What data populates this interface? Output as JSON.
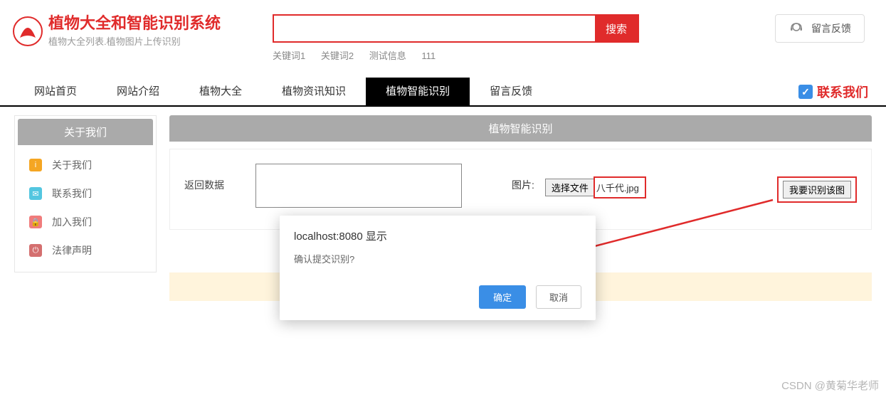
{
  "brand": {
    "title": "植物大全和智能识别系统",
    "subtitle": "植物大全列表.植物图片上传识别"
  },
  "search": {
    "placeholder": "",
    "button": "搜索",
    "keywords": [
      "关键词1",
      "关键词2",
      "测试信息",
      "111"
    ]
  },
  "feedback_button": "留言反馈",
  "nav": {
    "items": [
      "网站首页",
      "网站介绍",
      "植物大全",
      "植物资讯知识",
      "植物智能识别",
      "留言反馈"
    ],
    "active_index": 4
  },
  "contact_label": "联系我们",
  "sidebar": {
    "title": "关于我们",
    "items": [
      {
        "label": "关于我们",
        "icon_color": "#f5a623"
      },
      {
        "label": "联系我们",
        "icon_color": "#53c6e0"
      },
      {
        "label": "加入我们",
        "icon_color": "#f07c7c"
      },
      {
        "label": "法律声明",
        "icon_color": "#d46f6f"
      }
    ]
  },
  "main": {
    "title": "植物智能识别",
    "return_data_label": "返回数据",
    "textarea_value": "",
    "image_label": "图片:",
    "choose_file_button": "选择文件",
    "file_name": "八千代.jpg",
    "recognize_button": "我要识别该图"
  },
  "dialog": {
    "title": "localhost:8080 显示",
    "message": "确认提交识别?",
    "ok": "确定",
    "cancel": "取消"
  },
  "watermark": "CSDN @黄菊华老师"
}
